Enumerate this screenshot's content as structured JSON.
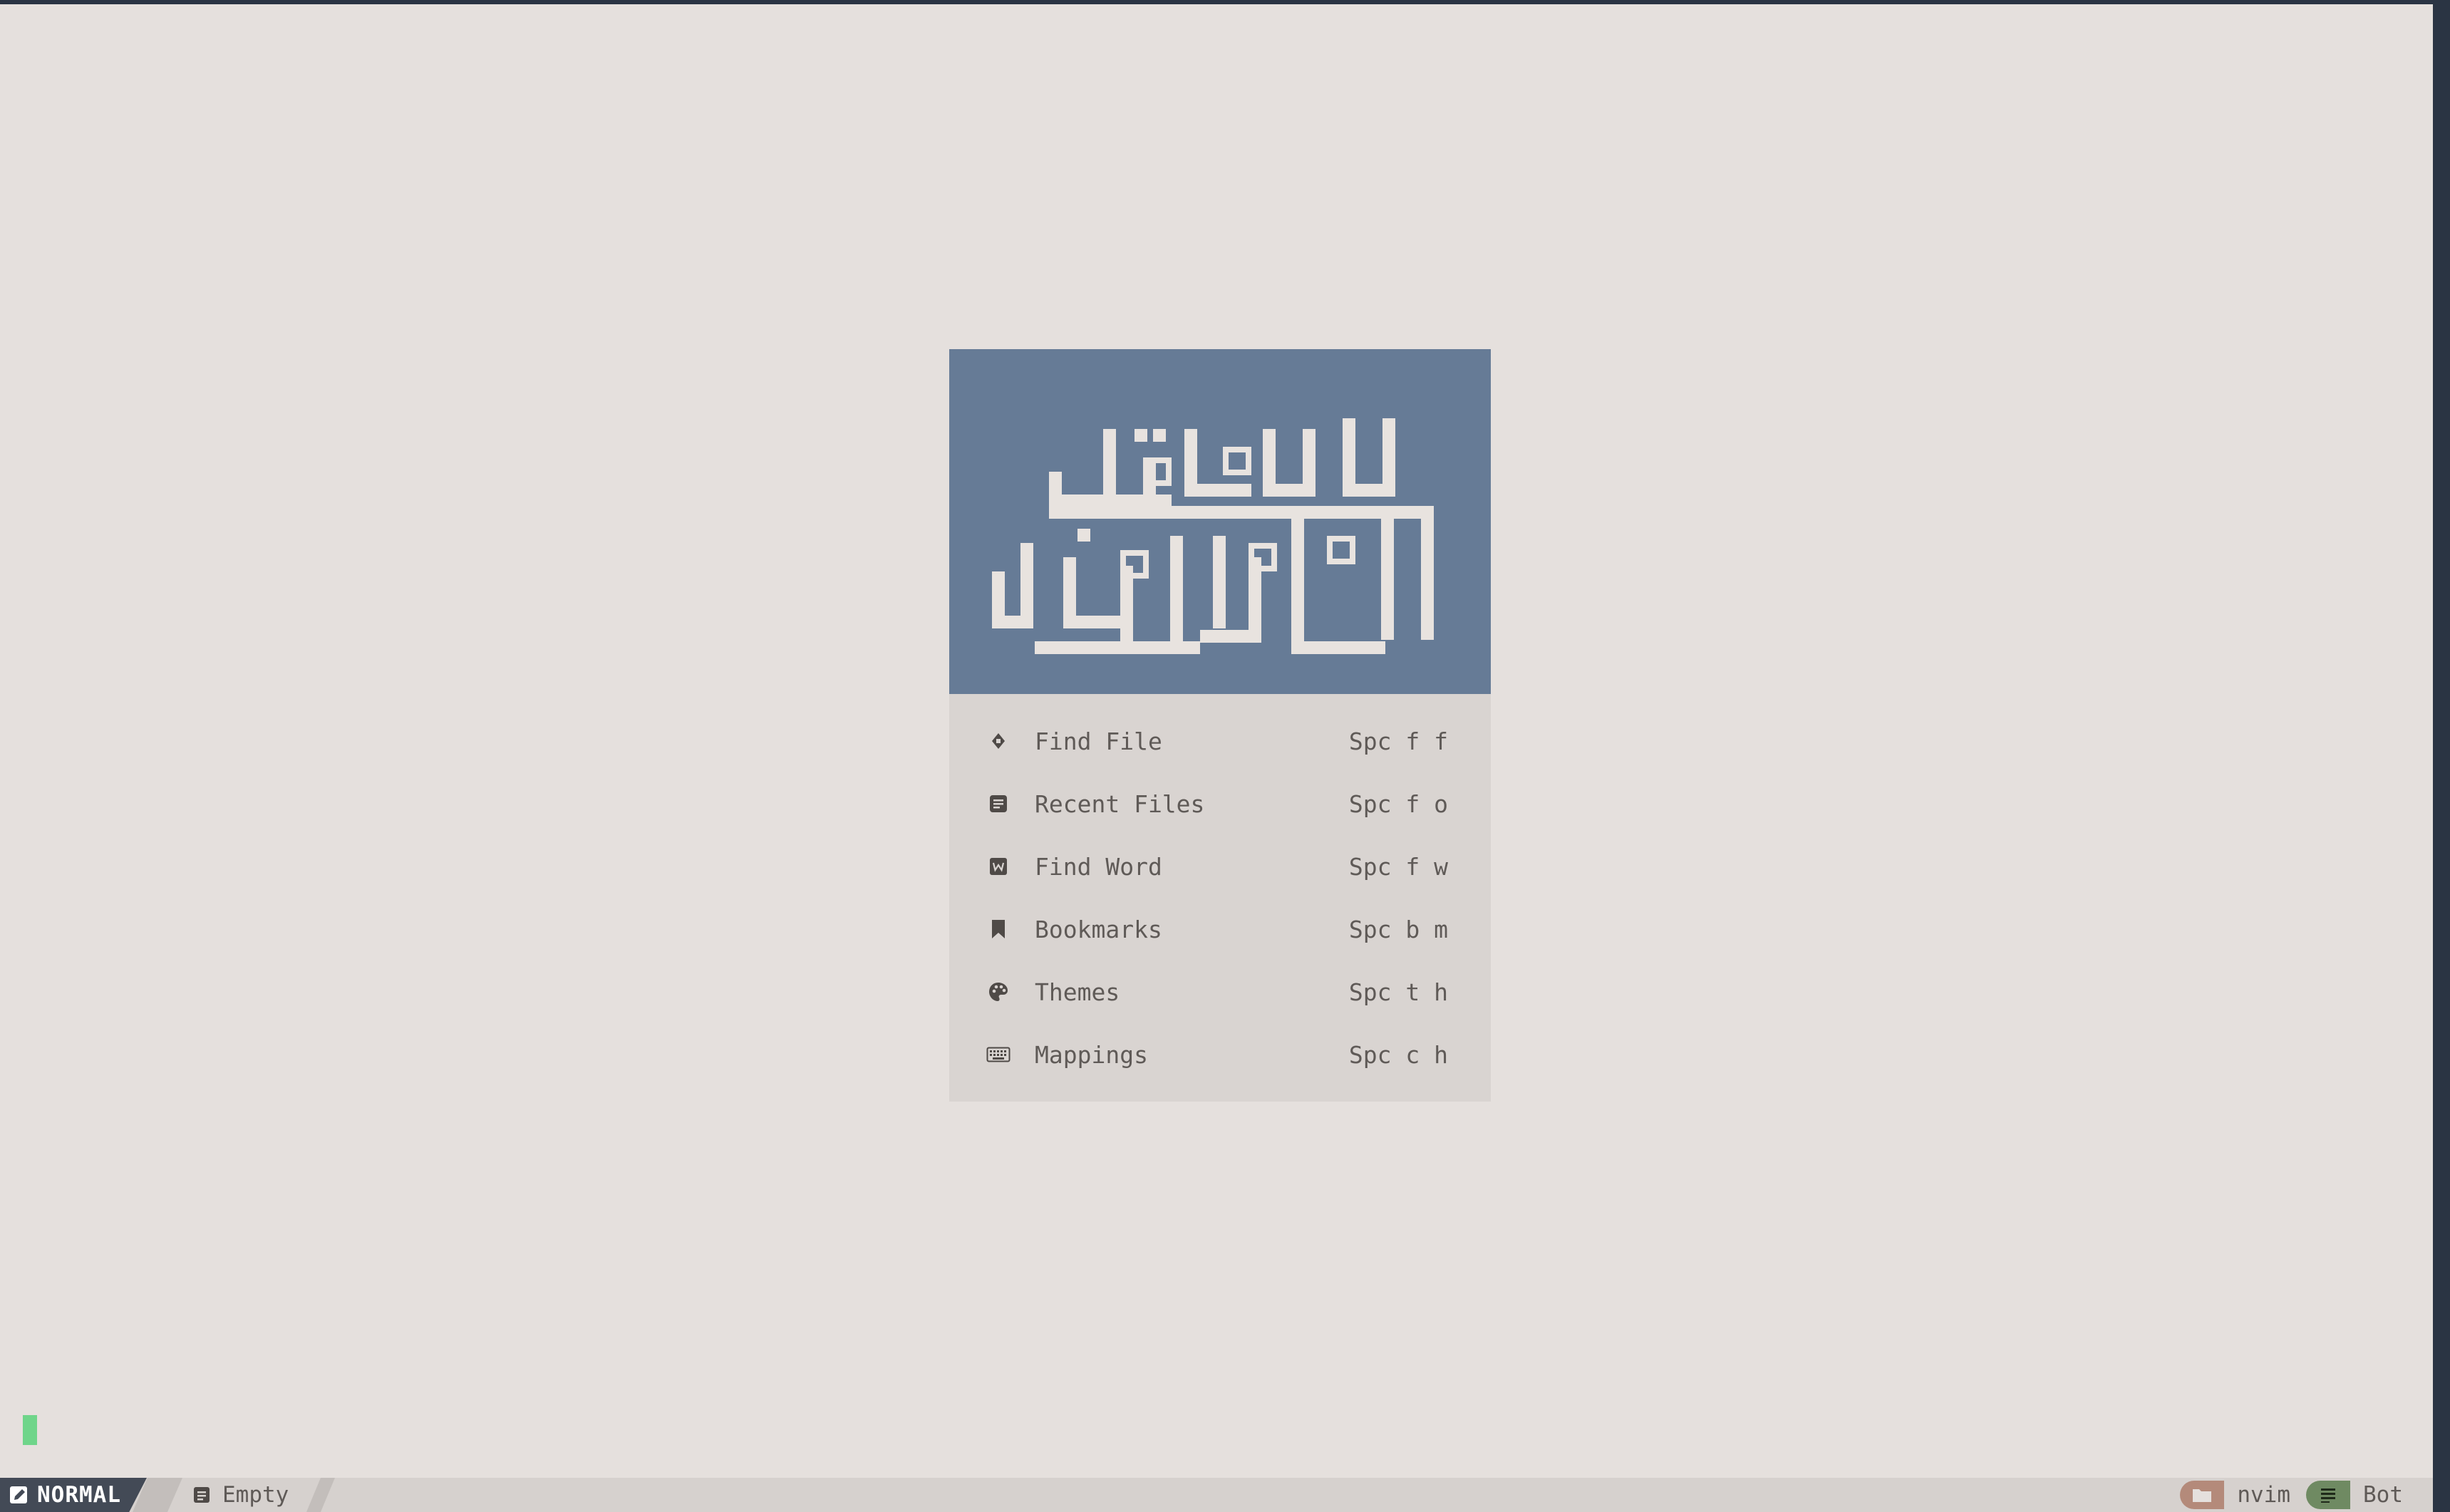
{
  "dashboard": {
    "header_art": "العلم قبل القول والعمل",
    "items": [
      {
        "icon": "file-search-icon",
        "label": "Find File",
        "keys": "Spc f f"
      },
      {
        "icon": "recent-files-icon",
        "label": "Recent Files",
        "keys": "Spc f o"
      },
      {
        "icon": "word-icon",
        "label": "Find Word",
        "keys": "Spc f w"
      },
      {
        "icon": "bookmark-icon",
        "label": "Bookmarks",
        "keys": "Spc b m"
      },
      {
        "icon": "palette-icon",
        "label": "Themes",
        "keys": "Spc t h"
      },
      {
        "icon": "keyboard-icon",
        "label": "Mappings",
        "keys": "Spc c h"
      }
    ]
  },
  "statusline": {
    "mode": "NORMAL",
    "file": "Empty",
    "directory": "nvim",
    "position": "Bot"
  },
  "colors": {
    "background": "#e5e0dd",
    "header": "#667b96",
    "menu_bg": "#d9d4d1",
    "cursor": "#6fd58a",
    "mode_bg": "#434a56",
    "dir_accent": "#b48a7a",
    "pos_accent": "#6f8a62"
  }
}
